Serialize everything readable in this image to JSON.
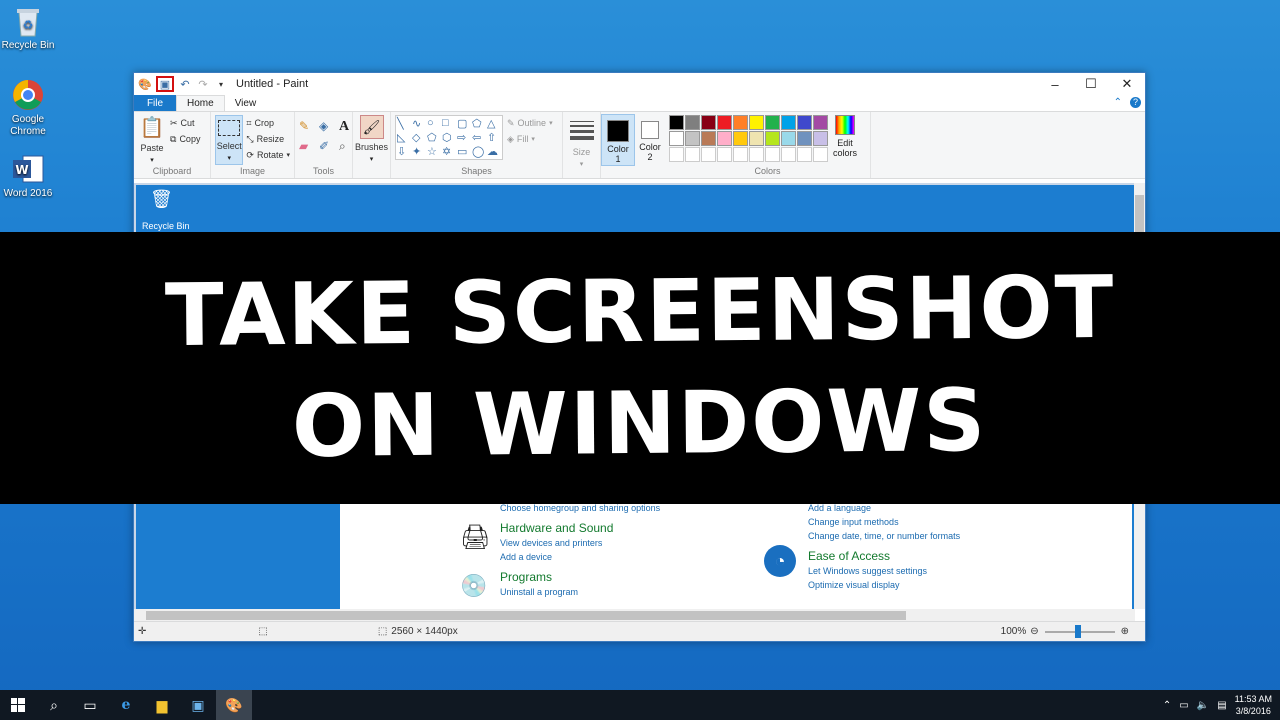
{
  "desktop": {
    "icons": [
      {
        "label": "Recycle Bin"
      },
      {
        "label": "Google Chrome"
      },
      {
        "label": "Word 2016"
      }
    ]
  },
  "paint": {
    "title": "Untitled - Paint",
    "tabs": {
      "file": "File",
      "home": "Home",
      "view": "View"
    },
    "clipboard": {
      "paste": "Paste",
      "cut": "Cut",
      "copy": "Copy",
      "label": "Clipboard"
    },
    "image": {
      "select": "Select",
      "crop": "Crop",
      "resize": "Resize",
      "rotate": "Rotate",
      "label": "Image"
    },
    "tools": {
      "label": "Tools"
    },
    "brushes": {
      "label": "Brushes"
    },
    "shapes": {
      "outline": "Outline",
      "fill": "Fill",
      "label": "Shapes"
    },
    "size": {
      "label": "Size"
    },
    "color1": {
      "label": "Color",
      "num": "1"
    },
    "color2": {
      "label": "Color",
      "num": "2"
    },
    "colors": {
      "label": "Colors",
      "edit": "Edit",
      "edit2": "colors"
    },
    "palette_row1": [
      "#000000",
      "#7f7f7f",
      "#880015",
      "#ed1c24",
      "#ff7f27",
      "#fff200",
      "#22b14c",
      "#00a2e8",
      "#3f48cc",
      "#a349a4"
    ],
    "palette_row2": [
      "#ffffff",
      "#c3c3c3",
      "#b97a57",
      "#ffaec9",
      "#ffc90e",
      "#efe4b0",
      "#b5e61d",
      "#99d9ea",
      "#7092be",
      "#c8bfe7"
    ],
    "status": {
      "dimensions": "2560 × 1440px",
      "zoom": "100%"
    },
    "captured": {
      "recycle_label": "Recycle Bin",
      "cp_left": {
        "top_link": "Choose homegroup and sharing options",
        "hw_head": "Hardware and Sound",
        "hw_links": [
          "View devices and printers",
          "Add a device"
        ],
        "prog_head": "Programs",
        "prog_links": [
          "Uninstall a program"
        ]
      },
      "cp_right": {
        "top_links": [
          "Add a language",
          "Change input methods",
          "Change date, time, or number formats"
        ],
        "ease_head": "Ease of Access",
        "ease_links": [
          "Let Windows suggest settings",
          "Optimize visual display"
        ]
      }
    }
  },
  "banner": {
    "line1": "TAKE SCREENSHOT",
    "line2": "ON WINDOWS"
  },
  "taskbar": {
    "time": "11:53 AM",
    "date": "3/8/2016"
  }
}
